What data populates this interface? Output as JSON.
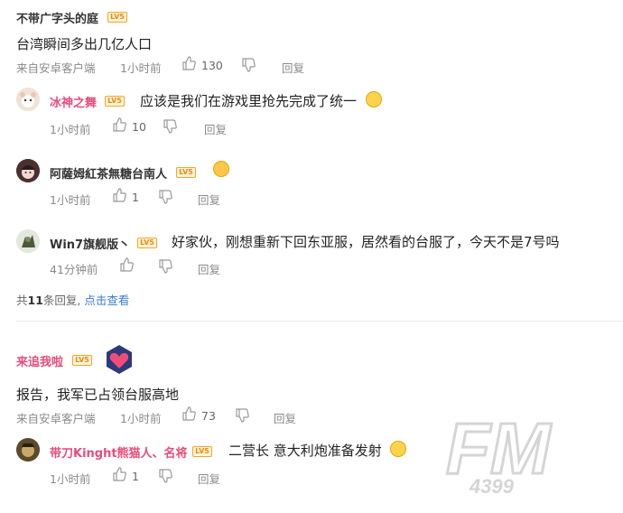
{
  "comments": [
    {
      "user": "不带广字头的庭",
      "level": "LV5",
      "text": "台湾瞬间多出几亿人口",
      "source": "来自安卓客户端",
      "time": "1小时前",
      "likes": "130",
      "reply_label": "回复",
      "replies": [
        {
          "user": "冰神之舞",
          "level": "LV5",
          "text": "应该是我们在游戏里抢先完成了统一",
          "time": "1小时前",
          "likes": "10",
          "reply_label": "回复",
          "name_color": "#e84c7a"
        },
        {
          "user": "阿薩姆紅茶無糖台南人",
          "level": "LV5",
          "text": "",
          "time": "1小时前",
          "likes": "1",
          "reply_label": "回复",
          "name_color": "#333333"
        },
        {
          "user": "Win7旗舰版丶",
          "level": "LV5",
          "text": "好家伙，刚想重新下回东亚服，居然看的台服了，今天不是7号吗",
          "time": "41分钟前",
          "likes": "",
          "reply_label": "回复",
          "name_color": "#333333"
        }
      ],
      "summary_prefix": "共",
      "summary_count": "11",
      "summary_suffix": "条回复,",
      "summary_link": "点击查看"
    },
    {
      "user": "来追我啦",
      "level": "LV5",
      "text": "报告，我军已占领台服高地",
      "source": "来自安卓客户端",
      "time": "1小时前",
      "likes": "73",
      "reply_label": "回复",
      "name_color": "#e84c7a",
      "replies": [
        {
          "user": "带刀Kinght熊猫人、名将",
          "level": "LV5",
          "text": "二营长  意大利炮准备发射",
          "time": "1小时前",
          "likes": "1",
          "reply_label": "回复",
          "name_color": "#e84c7a"
        }
      ]
    }
  ],
  "watermark": {
    "text": "FM",
    "sub": "4399"
  },
  "colors": {
    "pink_name": "#e84c7a",
    "link": "#3a7bd5",
    "meta": "#8a8a8a"
  }
}
